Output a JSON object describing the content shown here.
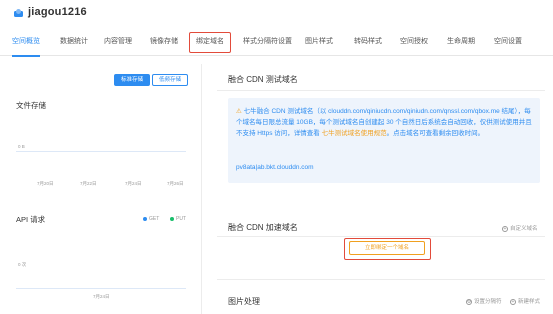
{
  "header": {
    "bucket_name": "jiagou1216",
    "bucket_icon": "cloud-bucket-icon"
  },
  "tabs": [
    {
      "label": "空间概览"
    },
    {
      "label": "数据统计"
    },
    {
      "label": "内容管理"
    },
    {
      "label": "镜像存储"
    },
    {
      "label": "绑定域名"
    },
    {
      "label": "样式分隔符设置"
    },
    {
      "label": "图片样式"
    },
    {
      "label": "转码样式"
    },
    {
      "label": "空间授权"
    },
    {
      "label": "生命周期"
    },
    {
      "label": "空间设置"
    }
  ],
  "active_tab": "空间概览",
  "highlighted_tab": "绑定域名",
  "storage_toggle": {
    "standard": "标准存储",
    "low_freq": "低频存储"
  },
  "storage": {
    "title": "文件存储",
    "y_value": "0 B",
    "x_ticks": [
      "7月20日",
      "7月22日",
      "7月24日",
      "7月26日"
    ]
  },
  "api": {
    "title": "API 请求",
    "legend_get": "GET",
    "legend_put": "PUT",
    "y_value": "0 次",
    "x_tick": "7月24日"
  },
  "cdn_test": {
    "title": "融合 CDN 测试域名",
    "notice": "七牛融合 CDN 测试域名（以 clouddn.com/qiniucdn.com/qiniudn.com/qnssl.com/qbox.me 结尾），每个域名每日限总流量 10GB，每个测试域名自创建起 30 个自然日后系统会自动回收，仅供测试使用并且不支持 Https 访问，详情查看",
    "notice_link": "七牛测试域名使用规范",
    "notice_tail": "。点击域名可查看剩余回收时间。",
    "domain": "pv8ata|ab.bkt.clouddn.com"
  },
  "cdn_accel": {
    "title": "融合 CDN 加速域名",
    "custom_link": "自定义域名",
    "bind_button": "立即绑定一个域名"
  },
  "image_proc": {
    "title": "图片处理",
    "set_separator": "设置分隔符",
    "new_style": "新建样式"
  },
  "colors": {
    "accent": "#2d8cf0",
    "warn": "#f0a020",
    "highlight_border": "#e24b3b",
    "get_dot": "#2d8cf0",
    "put_dot": "#19be6b"
  }
}
